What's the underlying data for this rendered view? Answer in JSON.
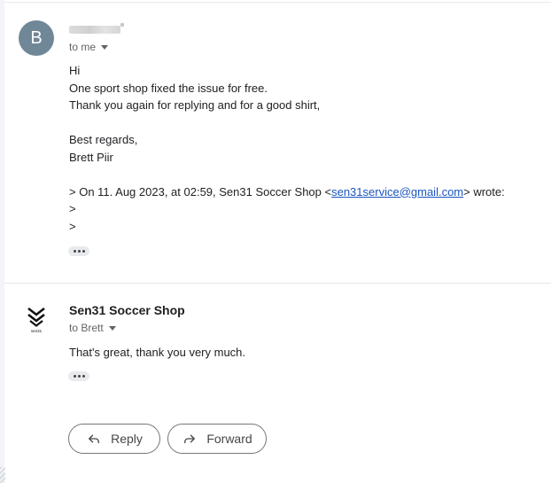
{
  "message1": {
    "avatar_letter": "B",
    "recipient_label": "to me",
    "body_lines": [
      "Hi",
      "One sport shop fixed the issue for free.",
      "Thank you again for replying and for a good shirt,",
      "",
      "Best regards,",
      "Brett Piir",
      ""
    ],
    "quote_prefix": "> On 11. Aug 2023, at 02:59, Sen31 Soccer Shop <",
    "quote_email": "sen31service@gmail.com",
    "quote_suffix": "> wrote:",
    "quote_marker_1": ">",
    "quote_marker_2": ">"
  },
  "message2": {
    "sender_name": "Sen31 Soccer Shop",
    "logo_text": "sen31",
    "recipient_label": "to Brett",
    "body_text": "That's great, thank you very much."
  },
  "actions": {
    "reply_label": "Reply",
    "forward_label": "Forward"
  },
  "colors": {
    "avatar_bg": "#6f8797",
    "link": "#1a55c0",
    "button_border": "#747775"
  },
  "icons": {
    "reply": "reply-arrow-icon",
    "forward": "forward-arrow-icon",
    "caret": "chevron-down-icon",
    "more": "more-horizontal-icon"
  }
}
